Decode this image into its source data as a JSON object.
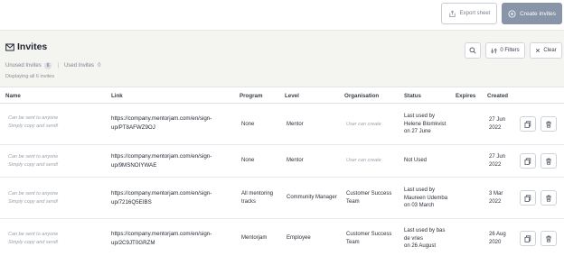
{
  "toolbar": {
    "export_label": "Export sheet",
    "create_label": "Create invites"
  },
  "page": {
    "title": "Invites",
    "filters_label": "0 Filters",
    "clear_label": "Clear",
    "tabs": [
      {
        "label": "Unused Invites",
        "count": "6"
      },
      {
        "label": "Used Invites",
        "count": "0"
      }
    ],
    "displaying": "Displaying all 6 invites"
  },
  "table": {
    "headers": [
      "Name",
      "Link",
      "Program",
      "Level",
      "Organisation",
      "Status",
      "Expires",
      "Created"
    ],
    "rows": [
      {
        "hint1": "Can be sent to anyone",
        "hint2": "Simply copy and send!",
        "link1": "https://company.mentorjam.com/en/sign-",
        "link2": "up/PT8AFWZ9OJ",
        "program1": "None",
        "program2": "",
        "level": "Mentor",
        "org1": "User can create",
        "org2": "",
        "status1": "Last used by",
        "status2": "Helene Blomkvist",
        "status3": "on 27 June",
        "expires": "",
        "created1": "27 Jun",
        "created2": "2022"
      },
      {
        "hint1": "Can be sent to anyone",
        "hint2": "Simply copy and send!",
        "link1": "https://company.mentorjam.com/en/sign-",
        "link2": "up/9MSNOIYWAE",
        "program1": "None",
        "program2": "",
        "level": "Mentor",
        "org1": "User can create",
        "org2": "",
        "status1": "Not Used",
        "status2": "",
        "status3": "",
        "expires": "",
        "created1": "27 Jun",
        "created2": "2022"
      },
      {
        "hint1": "Can be sent to anyone",
        "hint2": "Simply copy and send!",
        "link1": "https://company.mentorjam.com/en/sign-",
        "link2": "up/7216Q5EIBS",
        "program1": "All mentoring",
        "program2": "tracks",
        "level": "Community Manager",
        "org1": "Customer Success",
        "org2": "Team",
        "status1": "Last used by",
        "status2": "Maureen Udemba",
        "status3": "on 03 March",
        "expires": "",
        "created1": "3 Mar",
        "created2": "2022"
      },
      {
        "hint1": "Can be sent to anyone",
        "hint2": "Simply copy and send!",
        "link1": "https://company.mentorjam.com/en/sign-",
        "link2": "up/2C9JT0GRZM",
        "program1": "Mentorjam",
        "program2": "",
        "level": "Employee",
        "org1": "Customer Success",
        "org2": "Team",
        "status1": "Last used by bas",
        "status2": "de vries",
        "status3": "on 26 August",
        "expires": "",
        "created1": "26 Aug",
        "created2": "2020"
      }
    ]
  },
  "icons": {
    "export": "export-icon",
    "create": "plus-icon",
    "title": "envelope-icon",
    "search": "search-icon",
    "filter": "filter-icon",
    "clear": "close-icon",
    "copy": "copy-icon",
    "delete": "trash-icon"
  },
  "colors": {
    "accent": "#8894a8",
    "page_bg": "#f4f4f1"
  }
}
